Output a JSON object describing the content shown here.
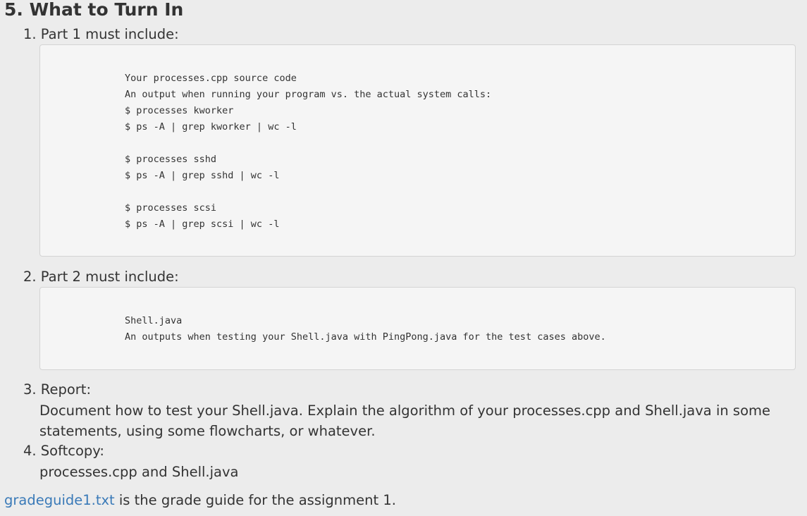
{
  "section": {
    "title": "5. What to Turn In"
  },
  "items": [
    {
      "heading": "1. Part 1 must include:",
      "code_lines": [
        "Your processes.cpp source code",
        "An output when running your program vs. the actual system calls:",
        "$ processes kworker",
        "$ ps -A | grep kworker | wc -l",
        "",
        "$ processes sshd",
        "$ ps -A | grep sshd | wc -l",
        "",
        "$ processes scsi",
        "$ ps -A | grep scsi | wc -l"
      ]
    },
    {
      "heading": "2. Part 2 must include:",
      "code_lines": [
        "Shell.java",
        "An outputs when testing your Shell.java with PingPong.java for the test cases above."
      ]
    },
    {
      "heading": "3. Report:",
      "text_lines": [
        "Document how to test your Shell.java. Explain the algorithm of your processes.cpp and Shell.java in some",
        "statements, using some flowcharts, or whatever."
      ]
    },
    {
      "heading": "4. Softcopy:",
      "text_lines": [
        "processes.cpp and Shell.java"
      ]
    }
  ],
  "footer": {
    "link_text": "gradeguide1.txt",
    "rest_text": " is the grade guide for the assignment 1."
  },
  "colors": {
    "background": "#ececec",
    "code_background": "#f5f5f5",
    "link": "#3a7ab8",
    "text": "#333333"
  }
}
